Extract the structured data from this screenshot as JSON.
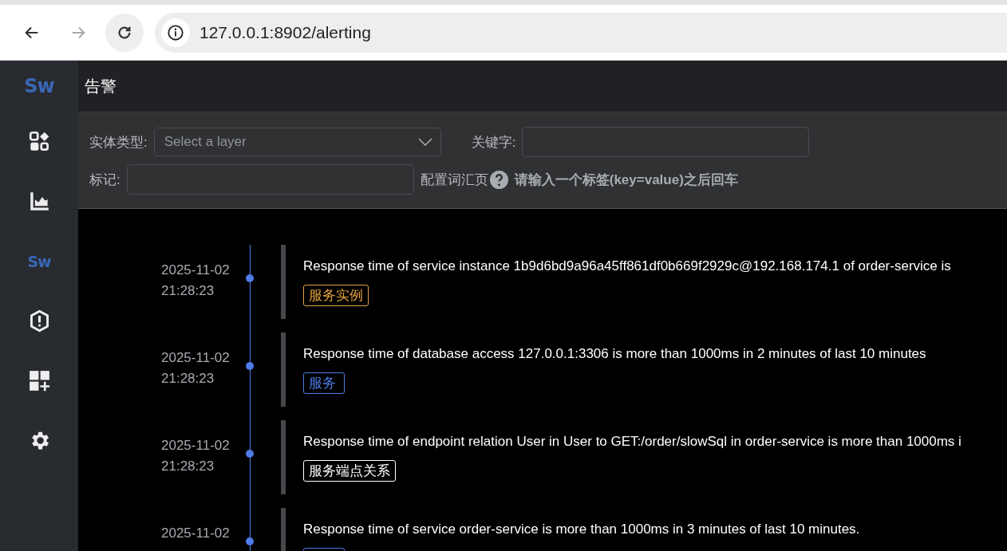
{
  "browser": {
    "url": "127.0.0.1:8902/alerting",
    "forward_disabled": true
  },
  "logo": "Sw",
  "page_title": "告警",
  "sidebar": {
    "items": [
      {
        "kind": "widgets"
      },
      {
        "kind": "chart"
      },
      {
        "kind": "logo",
        "label": "Sw"
      },
      {
        "kind": "alert"
      },
      {
        "kind": "add-dashboard"
      },
      {
        "kind": "settings"
      }
    ]
  },
  "filters": {
    "entity_type": {
      "label": "实体类型:",
      "placeholder": "Select a layer"
    },
    "keyword": {
      "label": "关键字:"
    },
    "tags": {
      "label": "标记:"
    },
    "help_link": "配置词汇页",
    "hint": "请输入一个标签(key=value)之后回车"
  },
  "alerts": [
    {
      "date": "2025-11-02",
      "time": "21:28:23",
      "message": "Response time of service instance 1b9d6bd9a96a45ff861df0b669f2929c@192.168.174.1 of order-service is",
      "tag": {
        "label": "服务实例",
        "color": "#e6a23c"
      }
    },
    {
      "date": "2025-11-02",
      "time": "21:28:23",
      "message": "Response time of database access 127.0.0.1:3306 is more than 1000ms in 2 minutes of last 10 minutes",
      "tag": {
        "label": "服务",
        "color": "#4e7be8"
      }
    },
    {
      "date": "2025-11-02",
      "time": "21:28:23",
      "message": "Response time of endpoint relation User in User to GET:/order/slowSql in order-service is more than 1000ms i",
      "tag": {
        "label": "服务端点关系",
        "color": "#ffffff"
      }
    },
    {
      "date": "2025-11-02",
      "message": "Response time of service order-service is more than 1000ms in 3 minutes of last 10 minutes.",
      "tag": {
        "color": "#4e7be8"
      }
    }
  ]
}
